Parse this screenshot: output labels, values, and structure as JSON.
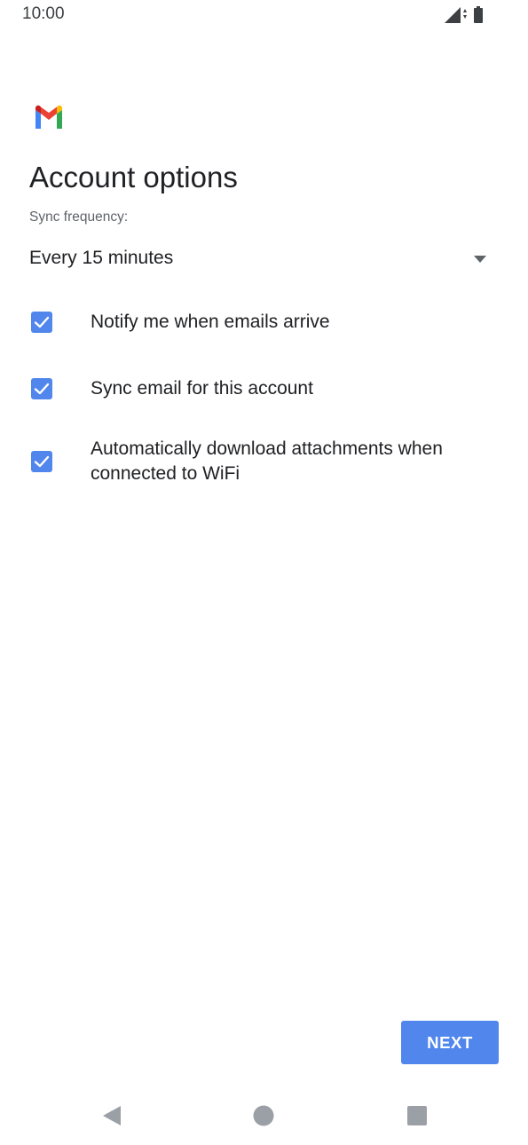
{
  "status_bar": {
    "time": "10:00",
    "icons": [
      "signal-icon",
      "data-arrows-icon",
      "battery-icon"
    ]
  },
  "app": {
    "logo": "gmail-logo"
  },
  "title": "Account options",
  "sync": {
    "label": "Sync frequency:",
    "value": "Every 15 minutes"
  },
  "options": [
    {
      "label": "Notify me when emails arrive",
      "checked": true
    },
    {
      "label": "Sync email for this account",
      "checked": true
    },
    {
      "label": "Automatically download attachments when connected to WiFi",
      "checked": true
    }
  ],
  "actions": {
    "next_label": "NEXT"
  },
  "colors": {
    "accent": "#5186ec",
    "text_primary": "#202124",
    "text_secondary": "#5f6368",
    "nav_icon": "#9aa0a6"
  },
  "navigation": [
    "back-icon",
    "home-icon",
    "recents-icon"
  ]
}
